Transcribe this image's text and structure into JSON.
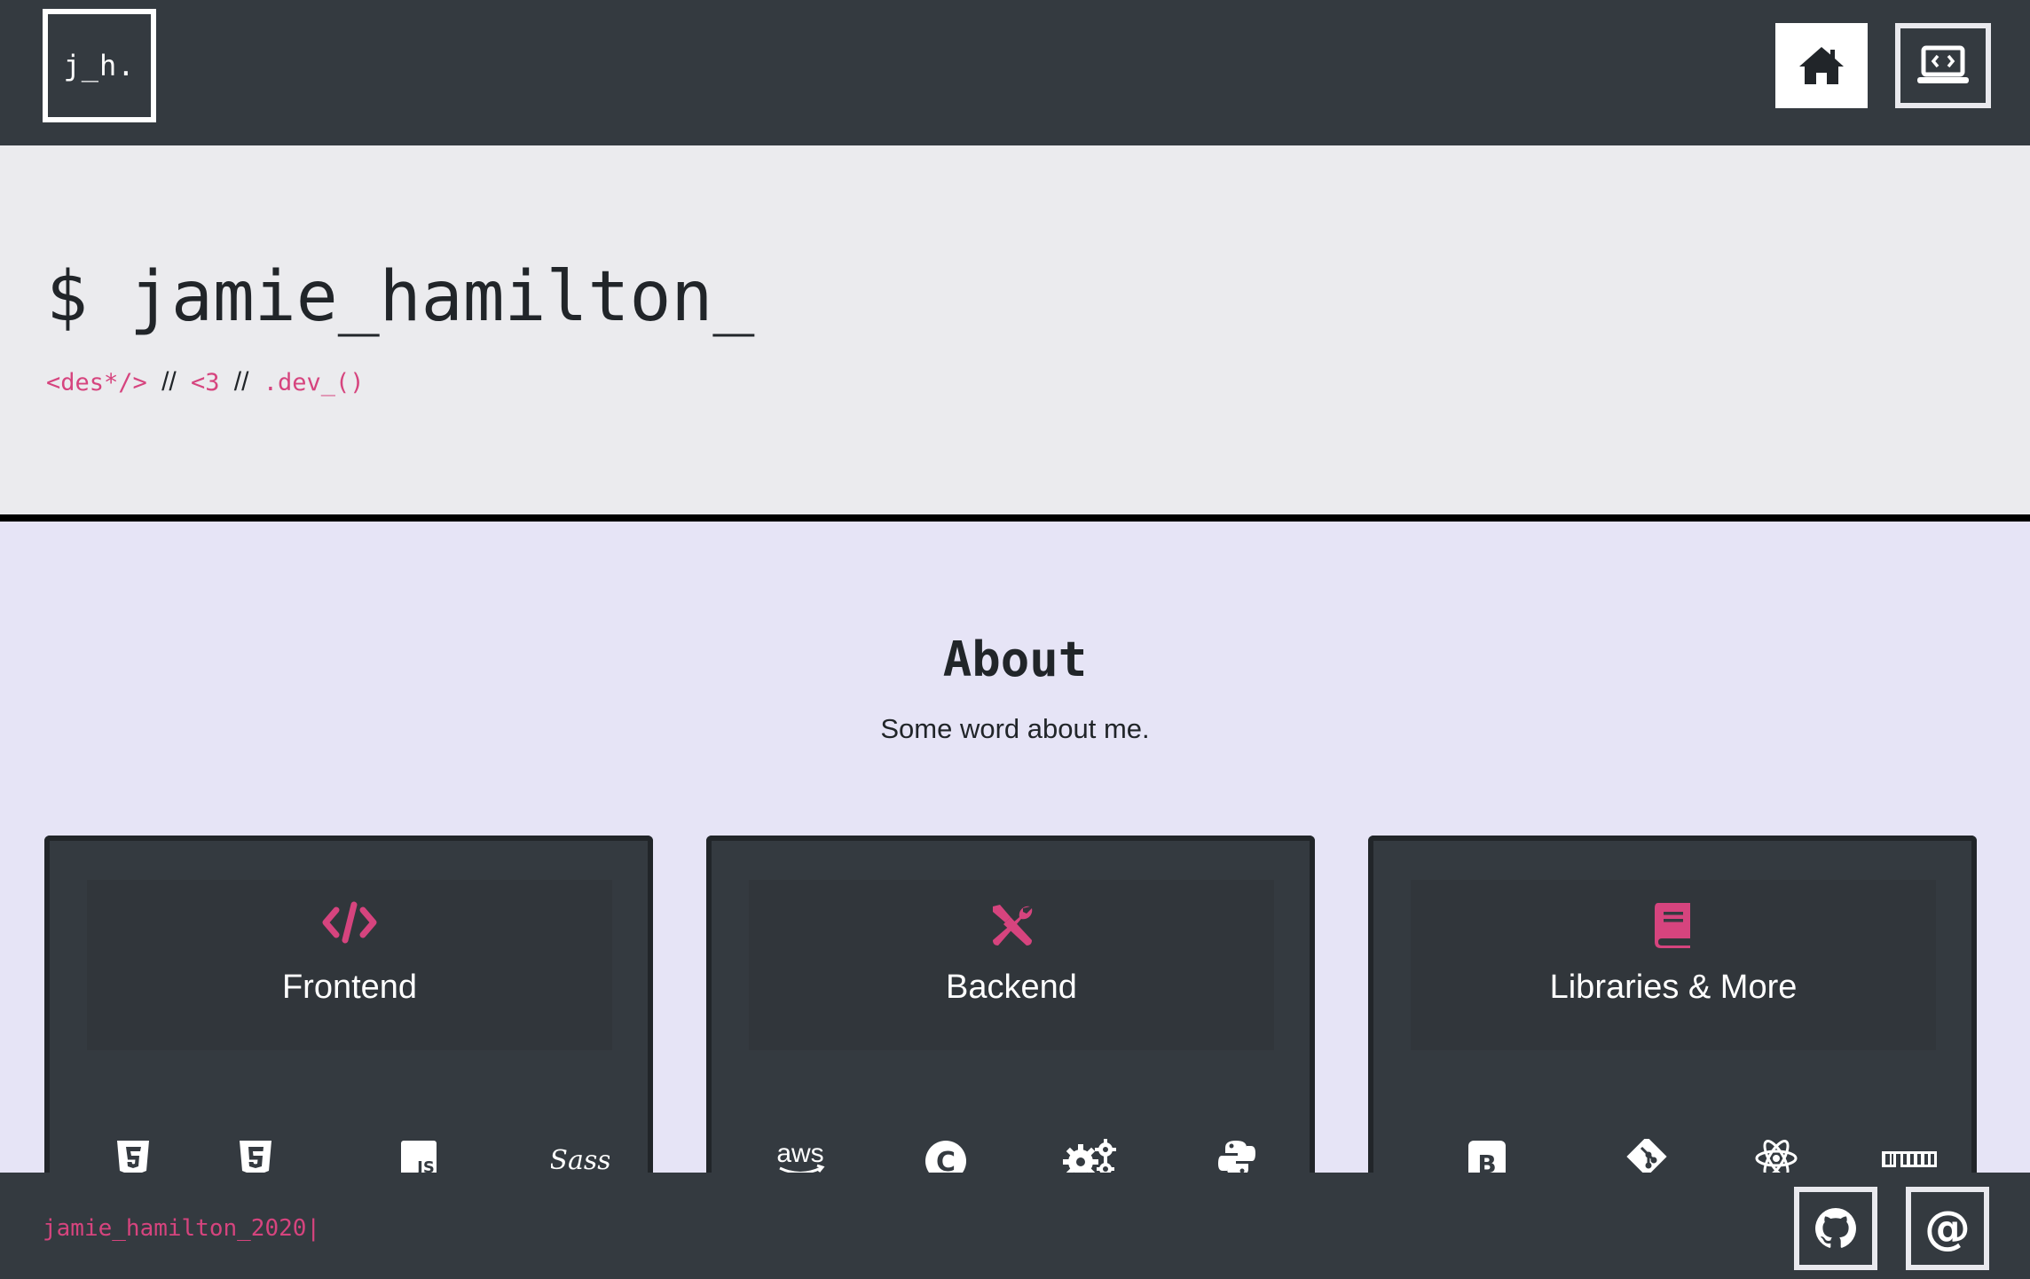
{
  "navbar": {
    "logo_text": "j_h.",
    "buttons": [
      {
        "icon": "home-icon"
      },
      {
        "icon": "laptop-code-icon"
      }
    ]
  },
  "hero": {
    "title": "$ jamie_hamilton_",
    "subtitle": {
      "part1": "<des*/>",
      "sep1": "//",
      "part2": "<3",
      "sep2": "//",
      "part3": ".dev_()"
    }
  },
  "about": {
    "title": "About",
    "subtitle": "Some word about me."
  },
  "cards": [
    {
      "label": "Frontend",
      "icon": "code-icon",
      "tech": [
        "css3-icon",
        "html5-icon",
        "javascript-icon",
        "sass-icon"
      ]
    },
    {
      "label": "Backend",
      "icon": "tools-icon",
      "tech": [
        "aws-icon",
        "c-icon",
        "gears-icon",
        "python-icon"
      ]
    },
    {
      "label": "Libraries & More",
      "icon": "book-icon",
      "tech": [
        "bootstrap-icon",
        "git-icon",
        "react-icon",
        "npm-icon"
      ]
    }
  ],
  "tech_labels": {
    "aws": "aws",
    "js": "JS",
    "sass": "Sass",
    "bootstrap": "B",
    "c": "C"
  },
  "footer": {
    "text": "jamie_hamilton_2020",
    "cursor": "|",
    "buttons": [
      {
        "icon": "github-icon"
      },
      {
        "icon": "at-icon",
        "glyph": "@"
      }
    ]
  },
  "colors": {
    "accent": "#d6447e",
    "dark": "#343a40",
    "hero_bg": "#ebebee",
    "about_bg": "#e6e4f6"
  }
}
